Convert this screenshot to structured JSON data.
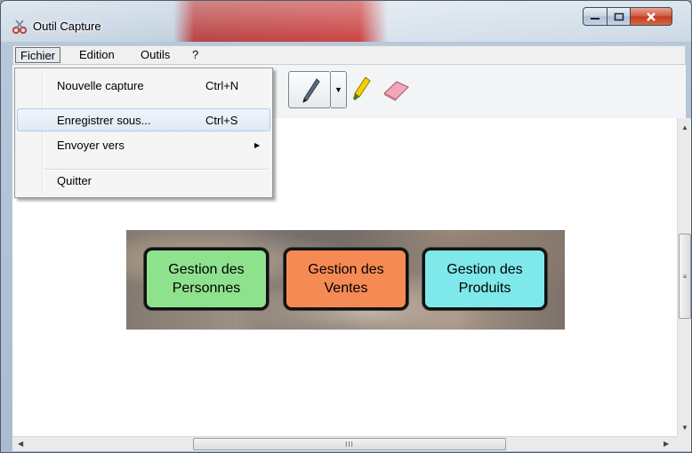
{
  "window": {
    "title": "Outil Capture"
  },
  "menubar": {
    "items": [
      "Fichier",
      "Edition",
      "Outils",
      "?"
    ]
  },
  "file_menu": {
    "items": [
      {
        "label": "Nouvelle capture",
        "shortcut": "Ctrl+N"
      },
      {
        "label": "Enregistrer sous...",
        "shortcut": "Ctrl+S"
      },
      {
        "label": "Envoyer vers",
        "shortcut": ""
      },
      {
        "label": "Quitter",
        "shortcut": ""
      }
    ],
    "highlighted": "Enregistrer sous..."
  },
  "banner": {
    "buttons": [
      {
        "label_line1": "Gestion des",
        "label_line2": "Personnes",
        "color": "#8ee28e"
      },
      {
        "label_line1": "Gestion des",
        "label_line2": "Ventes",
        "color": "#f58a55"
      },
      {
        "label_line1": "Gestion des",
        "label_line2": "Produits",
        "color": "#7fe8ea"
      }
    ]
  },
  "scrollbars": {
    "vertical_grip": "≡",
    "horizontal_grip": "III"
  },
  "icons": [
    "app-scissors-icon",
    "pen-icon",
    "highlighter-icon",
    "eraser-icon",
    "minimize-icon",
    "maximize-icon",
    "close-icon"
  ]
}
